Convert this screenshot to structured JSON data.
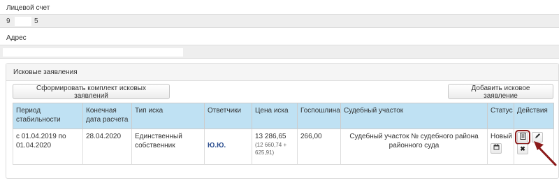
{
  "account": {
    "label": "Лицевой счет",
    "value_start": "9",
    "value_end": "5"
  },
  "address": {
    "label": "Адрес"
  },
  "claims_panel": {
    "title": "Исковые заявления",
    "form_button": "Сформировать комплект исковых заявлений",
    "add_button": "Добавить исковое заявление",
    "columns": [
      "Период стабильности",
      "Конечная дата расчета",
      "Тип иска",
      "Ответчики",
      "Цена иска",
      "Госпошлина",
      "Судебный участок",
      "Статус",
      "Действия"
    ],
    "rows": [
      {
        "period": "с 01.04.2019 по 01.04.2020",
        "end_date": "28.04.2020",
        "claim_type": "Единственный собственник",
        "defendants": "Ю.Ю.",
        "price": "13 286,65",
        "price_detail": "(12 660,74 + 625,91)",
        "duty": "266,00",
        "court": "Судебный участок №    судебного района                       районного суда",
        "status": "Новый"
      }
    ]
  },
  "icons": {
    "calendar": "calendar-icon",
    "document": "document-icon",
    "edit": "pencil-icon",
    "delete": "close-icon"
  },
  "colors": {
    "header_bg": "#bfe1f3",
    "highlight": "#8b1a1a"
  }
}
